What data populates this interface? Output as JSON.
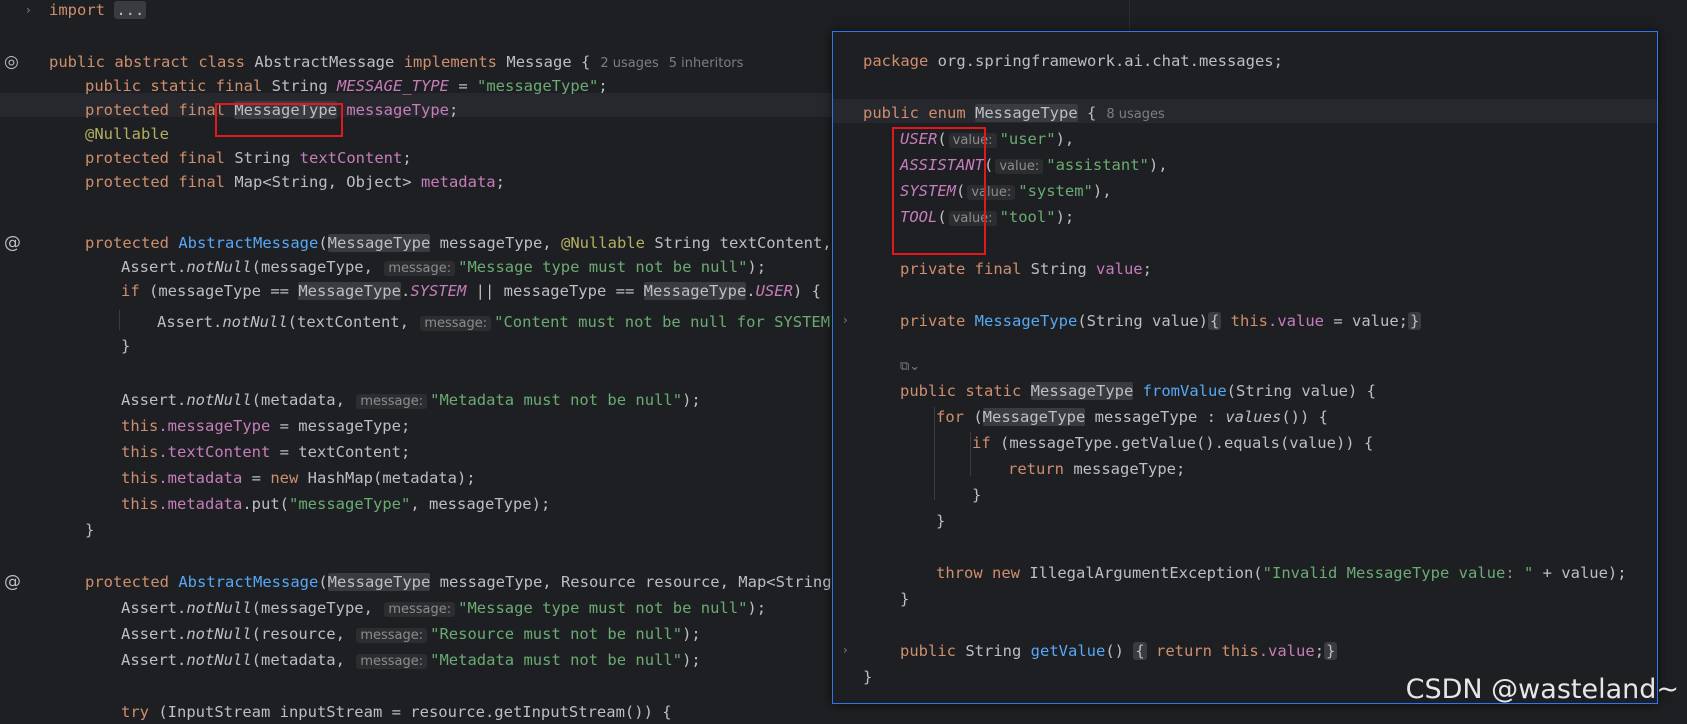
{
  "editor": {
    "import_keyword": "import",
    "import_fold": "...",
    "class_decl": {
      "mod_public": "public",
      "mod_abstract": "abstract",
      "kw_class": "class",
      "name": "AbstractMessage",
      "kw_implements": "implements",
      "iface": "Message",
      "brace": "{",
      "usages": "2 usages",
      "inheritors": "5 inheritors"
    },
    "field_message_type_const": {
      "mods": "public static final",
      "type": "String",
      "name": "MESSAGE_TYPE",
      "eq": "=",
      "value": "\"messageType\"",
      "semi": ";"
    },
    "field_message_type": {
      "mods": "protected final",
      "type": "MessageType",
      "name": "messageType",
      "semi": ";"
    },
    "nullable": "@Nullable",
    "field_text_content": {
      "mods": "protected final",
      "type": "String",
      "name": "textContent",
      "semi": ";"
    },
    "field_metadata": {
      "mods": "protected final",
      "type": "Map<String, Object>",
      "name": "metadata",
      "semi": ";"
    },
    "ctor1": {
      "mod": "protected",
      "name": "AbstractMessage",
      "open": "(",
      "p1_type": "MessageType",
      "p1_rest": " messageType, ",
      "p2_ann": "@Nullable",
      "p2_rest": " String textContent, Ma"
    },
    "ctor1_body": {
      "l1_pre": "Assert.",
      "l1_fn": "notNull",
      "l1_args": "(messageType, ",
      "l1_hint": "message:",
      "l1_str": "\"Message type must not be null\"",
      "l1_end": ");",
      "l2_kw": "if",
      "l2_a": " (messageType == ",
      "l2_t1": "MessageType",
      "l2_dot1": ".",
      "l2_c1": "SYSTEM",
      "l2_b": " || messageType == ",
      "l2_t2": "MessageType",
      "l2_dot2": ".",
      "l2_c2": "USER",
      "l2_end": ") {",
      "l3_pre": "Assert.",
      "l3_fn": "notNull",
      "l3_args": "(textContent, ",
      "l3_hint": "message:",
      "l3_str": "\"Content must not be null for SYSTEM or",
      "l4": "}",
      "l5_pre": "Assert.",
      "l5_fn": "notNull",
      "l5_args": "(metadata, ",
      "l5_hint": "message:",
      "l5_str": "\"Metadata must not be null\"",
      "l5_end": ");",
      "l6_this": "this",
      "l6_fld": ".messageType",
      "l6_rest": " = messageType;",
      "l7_this": "this",
      "l7_fld": ".textContent",
      "l7_rest": " = textContent;",
      "l8_this": "this",
      "l8_fld": ".metadata",
      "l8_eq": " = ",
      "l8_new": "new",
      "l8_rest": " HashMap(metadata);",
      "l9_this": "this",
      "l9_fld": ".metadata",
      "l9_put": ".put(",
      "l9_str": "\"messageType\"",
      "l9_rest": ", messageType);",
      "l10": "}"
    },
    "ctor2": {
      "mod": "protected",
      "name": "AbstractMessage",
      "open": "(",
      "p1_type": "MessageType",
      "p1_rest": " messageType, Resource resource, Map<String, O"
    },
    "ctor2_body": {
      "l1_pre": "Assert.",
      "l1_fn": "notNull",
      "l1_args": "(messageType, ",
      "l1_hint": "message:",
      "l1_str": "\"Message type must not be null\"",
      "l1_end": ");",
      "l2_pre": "Assert.",
      "l2_fn": "notNull",
      "l2_args": "(resource, ",
      "l2_hint": "message:",
      "l2_str": "\"Resource must not be null\"",
      "l2_end": ");",
      "l3_pre": "Assert.",
      "l3_fn": "notNull",
      "l3_args": "(metadata, ",
      "l3_hint": "message:",
      "l3_str": "\"Metadata must not be null\"",
      "l3_end": ");",
      "l4_kw": "try",
      "l4_rest": " (InputStream inputStream = resource.getInputStream()) {"
    }
  },
  "popup": {
    "package_kw": "package",
    "package_name": " org.springframework.ai.chat.messages;",
    "enum_public": "public",
    "enum_kw": "enum",
    "enum_name": "MessageType",
    "enum_brace": "{",
    "enum_usages": "8 usages",
    "constants": [
      {
        "name": "USER",
        "open": "(",
        "hint": "value:",
        "str": "\"user\"",
        "end": "),"
      },
      {
        "name": "ASSISTANT",
        "open": "(",
        "hint": "value:",
        "str": "\"assistant\"",
        "end": "),"
      },
      {
        "name": "SYSTEM",
        "open": "(",
        "hint": "value:",
        "str": "\"system\"",
        "end": "),"
      },
      {
        "name": "TOOL",
        "open": "(",
        "hint": "value:",
        "str": "\"tool\"",
        "end": ");"
      }
    ],
    "value_field": {
      "mods": "private final",
      "type": " String ",
      "name": "value",
      "semi": ";"
    },
    "ctor": {
      "mod": "private",
      "name": "MessageType",
      "params": "(String value)",
      "ob": "{",
      "this": "this",
      "fld": ".value",
      "rest": " = value;",
      "cb": "}"
    },
    "marker": "⧉⌄",
    "from_value": {
      "mods": "public static",
      "type": "MessageType",
      "name": "fromValue",
      "params": "(String value) {"
    },
    "for_line": {
      "kw": "for",
      "open": " (",
      "type": "MessageType",
      "mid": " messageType : ",
      "fn": "values",
      "end": "()) {"
    },
    "if_line": {
      "kw": "if",
      "rest": " (messageType.getValue().equals(value)) {"
    },
    "return_line": {
      "kw": "return",
      "rest": " messageType;"
    },
    "close_if": "}",
    "close_for": "}",
    "throw_line": {
      "kw1": "throw",
      "kw2": "new",
      "cls": " IllegalArgumentException(",
      "str": "\"Invalid MessageType value: \"",
      "rest": " + value);"
    },
    "close_method": "}",
    "getter": {
      "mods": "public",
      "type": " String ",
      "name": "getValue",
      "params": "()",
      "ob": "{",
      "kw": "return",
      "this": "this",
      "fld": ".value",
      "semi": ";",
      "cb": "}"
    },
    "close_enum": "}"
  },
  "watermark": "CSDN @wasteland~"
}
